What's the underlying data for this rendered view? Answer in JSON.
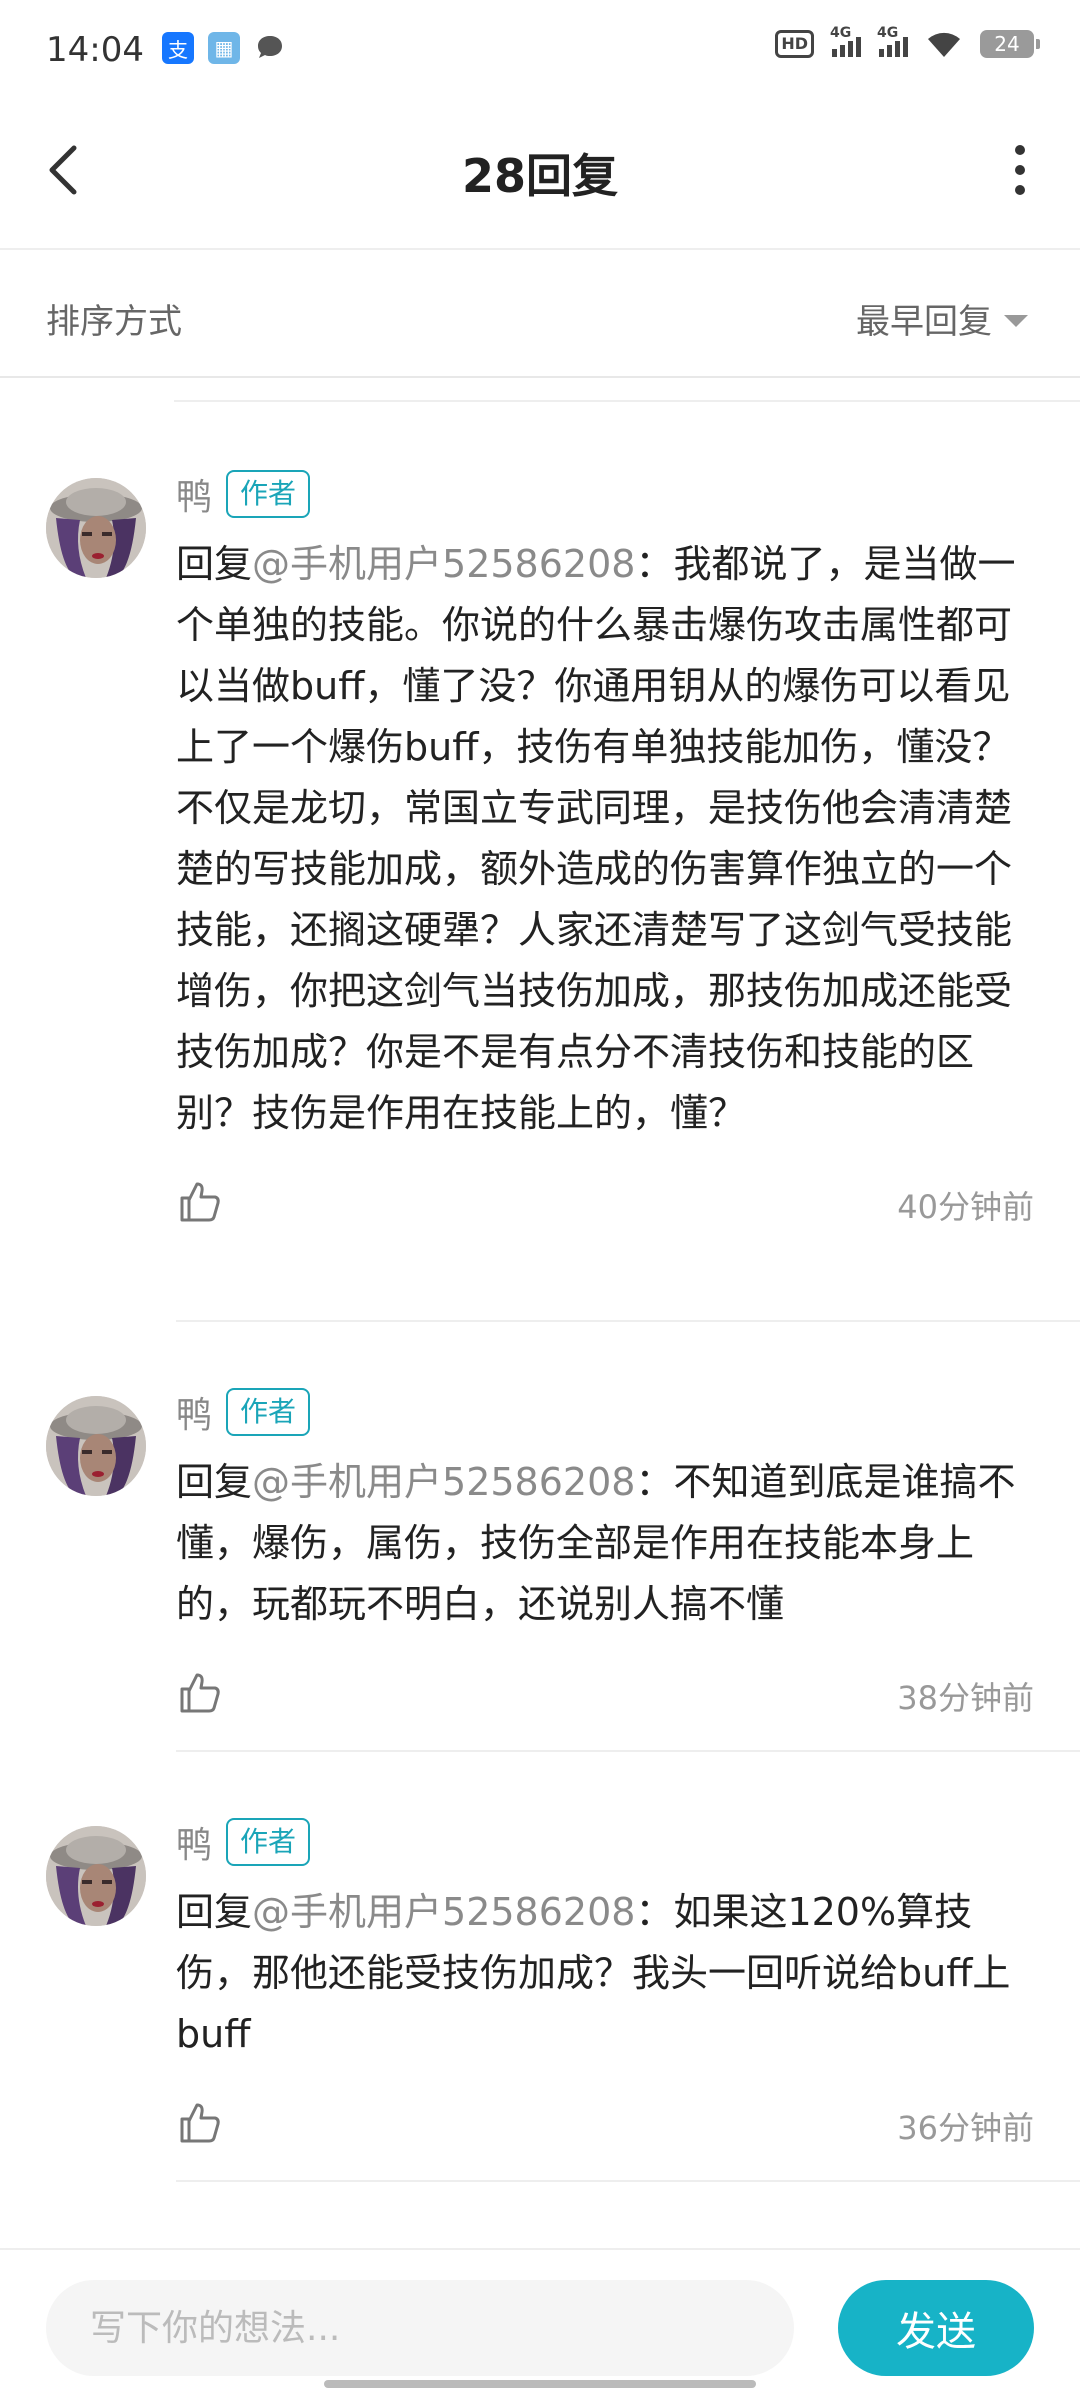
{
  "status_bar": {
    "time": "14:04",
    "hd": "HD",
    "net1": "4G",
    "net2": "4G",
    "battery": "24",
    "icons": [
      "alipay-icon",
      "app-icon",
      "message-icon"
    ]
  },
  "header": {
    "title": "28回复",
    "back_icon": "chevron-left-icon",
    "more_icon": "more-vertical-icon"
  },
  "sort": {
    "label": "排序方式",
    "selected": "最早回复"
  },
  "comments": [
    {
      "user": "鸭",
      "tag": "作者",
      "prefix": "回复",
      "mention": "@手机用户52586208",
      "text": "：我都说了，是当做一个单独的技能。你说的什么暴击爆伤攻击属性都可以当做buff，懂了没？你通用钥从的爆伤可以看见上了一个爆伤buff，技伤有单独技能加伤，懂没？不仅是龙切，常国立专武同理，是技伤他会清清楚楚的写技能加成，额外造成的伤害算作独立的一个技能，还搁这硬犟？人家还清楚写了这剑气受技能增伤，你把这剑气当技伤加成，那技伤加成还能受技伤加成？你是不是有点分不清技伤和技能的区别？技伤是作用在技能上的，懂？",
      "time": "40分钟前"
    },
    {
      "user": "鸭",
      "tag": "作者",
      "prefix": "回复",
      "mention": "@手机用户52586208",
      "text": "：不知道到底是谁搞不懂，爆伤，属伤，技伤全部是作用在技能本身上的，玩都玩不明白，还说别人搞不懂",
      "time": "38分钟前"
    },
    {
      "user": "鸭",
      "tag": "作者",
      "prefix": "回复",
      "mention": "@手机用户52586208",
      "text": "：如果这120%算技伤，那他还能受技伤加成？我头一回听说给buff上buff",
      "time": "36分钟前"
    }
  ],
  "bottom": {
    "placeholder": "写下你的想法...",
    "send": "发送"
  },
  "colors": {
    "accent": "#17b3c7",
    "author_tag": "#1aa5b8",
    "mention": "#8a8a8a"
  }
}
